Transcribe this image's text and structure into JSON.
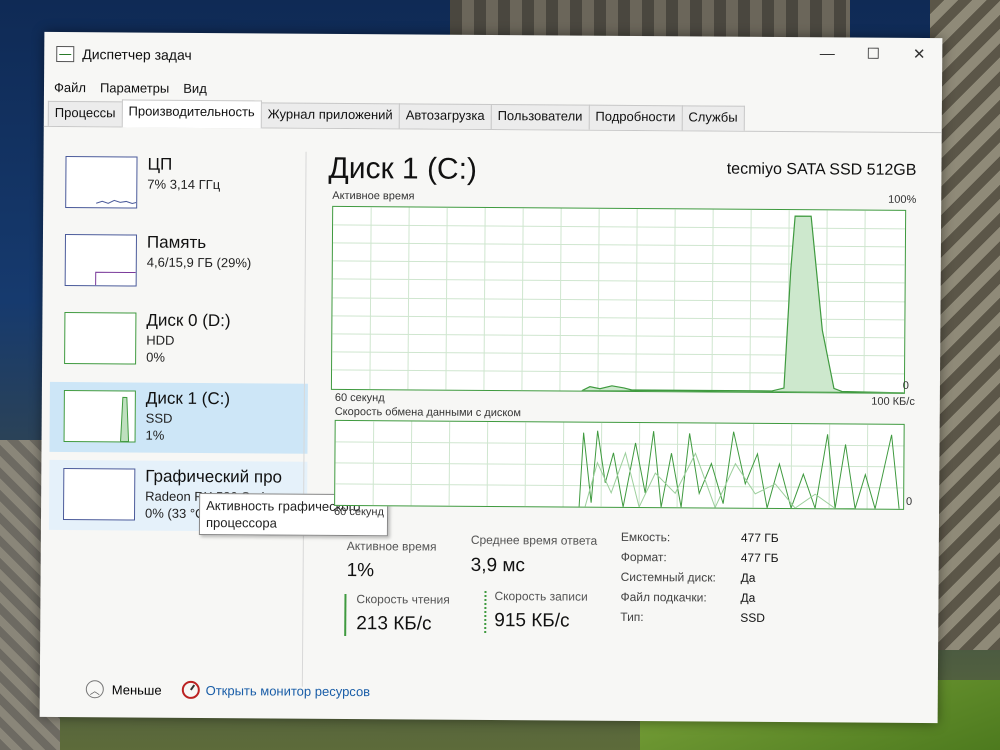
{
  "window": {
    "title": "Диспетчер задач",
    "controls": {
      "minimize": "—",
      "maximize": "☐",
      "close": "✕"
    }
  },
  "menu": [
    "Файл",
    "Параметры",
    "Вид"
  ],
  "tabs": [
    "Процессы",
    "Производительность",
    "Журнал приложений",
    "Автозагрузка",
    "Пользователи",
    "Подробности",
    "Службы"
  ],
  "active_tab": "Производительность",
  "sidebar": {
    "items": [
      {
        "title": "ЦП",
        "line1": "7% 3,14 ГГц",
        "line2": ""
      },
      {
        "title": "Память",
        "line1": "4,6/15,9 ГБ (29%)",
        "line2": ""
      },
      {
        "title": "Диск 0 (D:)",
        "line1": "HDD",
        "line2": "0%"
      },
      {
        "title": "Диск 1 (C:)",
        "line1": "SSD",
        "line2": "1%"
      },
      {
        "title": "Графический про",
        "line1": "Radeon RX 580 Series",
        "line2": "0% (33 °C)"
      }
    ]
  },
  "tooltip": {
    "line1": "Активность графического",
    "line2": "процессора"
  },
  "main": {
    "title": "Диск 1 (C:)",
    "model": "tecmiyo SATA SSD 512GB",
    "graph1": {
      "label": "Активное время",
      "max": "100%",
      "min": "0",
      "duration": "60 секунд"
    },
    "graph2": {
      "label": "Скорость обмена данными с диском",
      "max": "100 КБ/с",
      "min": "0",
      "duration": "60 секунд"
    }
  },
  "stats": {
    "active_time_label": "Активное время",
    "active_time_value": "1%",
    "avg_response_label": "Среднее время ответа",
    "avg_response_value": "3,9 мс",
    "read_speed_label": "Скорость чтения",
    "read_speed_value": "213 КБ/с",
    "write_speed_label": "Скорость записи",
    "write_speed_value": "915 КБ/с",
    "properties": [
      {
        "k": "Емкость:",
        "v": "477 ГБ"
      },
      {
        "k": "Формат:",
        "v": "477 ГБ"
      },
      {
        "k": "Системный диск:",
        "v": "Да"
      },
      {
        "k": "Файл подкачки:",
        "v": "Да"
      },
      {
        "k": "Тип:",
        "v": "SSD"
      }
    ]
  },
  "footer": {
    "less": "Меньше",
    "resource_monitor": "Открыть монитор ресурсов"
  },
  "colors": {
    "disk_green": "#3f9a3f",
    "cpu_blue": "#4a5a9a",
    "selection": "#cde6f7",
    "link": "#1a5ea8"
  }
}
